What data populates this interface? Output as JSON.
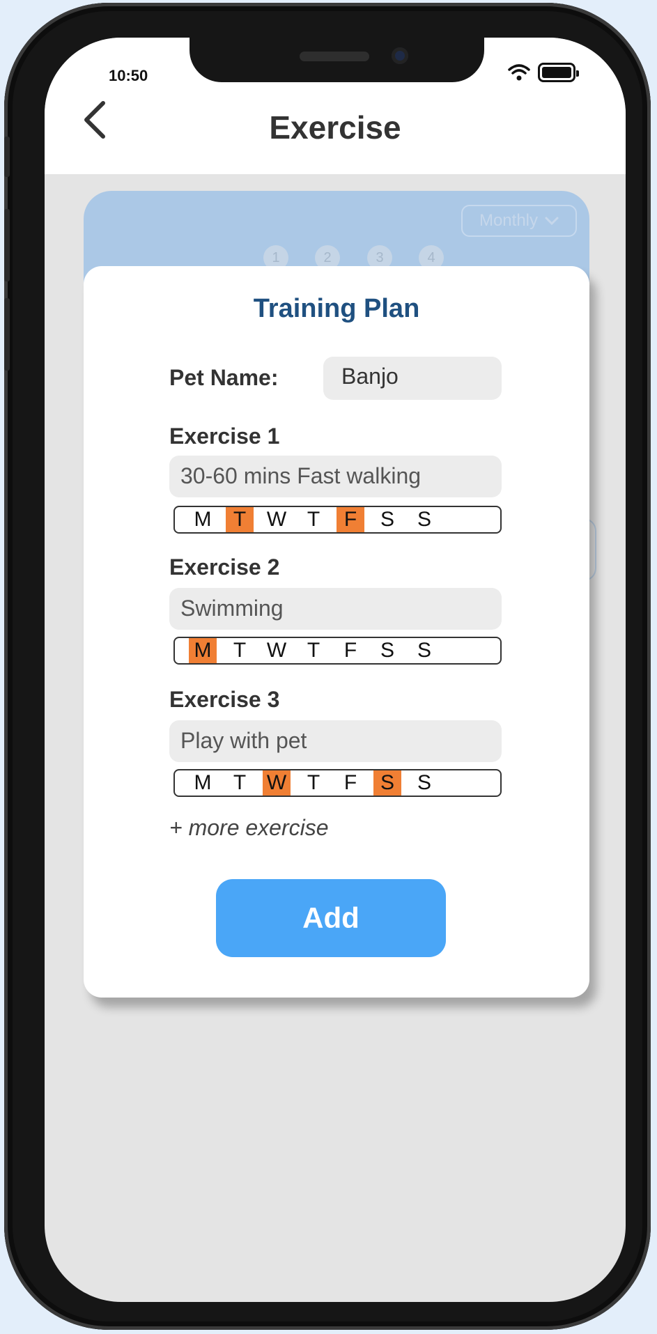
{
  "status_bar": {
    "time": "10:50"
  },
  "header": {
    "title": "Exercise"
  },
  "background_card": {
    "period_select": "Monthly",
    "week_numbers": [
      "1",
      "2",
      "3",
      "4"
    ]
  },
  "modal": {
    "title": "Training Plan",
    "pet_name_label": "Pet Name:",
    "pet_name_value": "Banjo",
    "exercises": [
      {
        "label": "Exercise 1",
        "value": "30-60 mins Fast walking",
        "days": [
          {
            "letter": "M",
            "selected": false
          },
          {
            "letter": "T",
            "selected": true
          },
          {
            "letter": "W",
            "selected": false
          },
          {
            "letter": "T",
            "selected": false
          },
          {
            "letter": "F",
            "selected": true
          },
          {
            "letter": "S",
            "selected": false
          },
          {
            "letter": "S",
            "selected": false
          }
        ]
      },
      {
        "label": "Exercise 2",
        "value": "Swimming",
        "days": [
          {
            "letter": "M",
            "selected": true
          },
          {
            "letter": "T",
            "selected": false
          },
          {
            "letter": "W",
            "selected": false
          },
          {
            "letter": "T",
            "selected": false
          },
          {
            "letter": "F",
            "selected": false
          },
          {
            "letter": "S",
            "selected": false
          },
          {
            "letter": "S",
            "selected": false
          }
        ]
      },
      {
        "label": "Exercise 3",
        "value": "Play with pet",
        "days": [
          {
            "letter": "M",
            "selected": false
          },
          {
            "letter": "T",
            "selected": false
          },
          {
            "letter": "W",
            "selected": true
          },
          {
            "letter": "T",
            "selected": false
          },
          {
            "letter": "F",
            "selected": false
          },
          {
            "letter": "S",
            "selected": true
          },
          {
            "letter": "S",
            "selected": false
          }
        ]
      }
    ],
    "more_link": "+ more exercise",
    "add_button": "Add"
  },
  "colors": {
    "accent_orange": "#f07f34",
    "button_blue": "#4aa6f7",
    "title_blue": "#1f5080",
    "card_blue": "#abc8e6"
  }
}
